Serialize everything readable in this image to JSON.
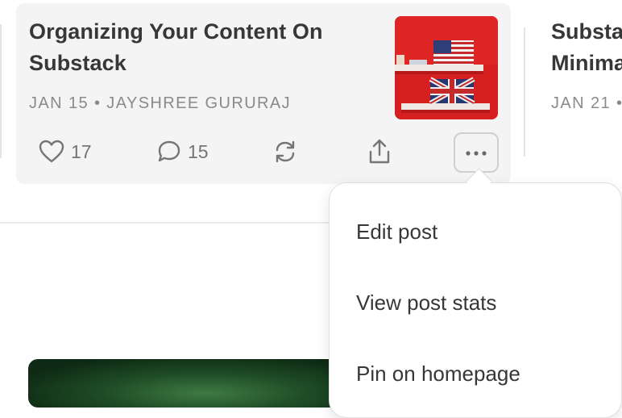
{
  "post": {
    "title": "Organizing Your Content On Substack",
    "meta": "JAN 15 • JAYSHREE GURURAJ",
    "likes": "17",
    "comments": "15"
  },
  "next_post": {
    "title_line1": "Substa",
    "title_line2": "Minima",
    "meta": "JAN 21 •"
  },
  "menu": {
    "items": [
      {
        "label": "Edit post"
      },
      {
        "label": "View post stats"
      },
      {
        "label": "Pin on homepage"
      }
    ]
  },
  "icons": {
    "like": "heart-icon",
    "comment": "comment-icon",
    "restack": "restack-icon",
    "share": "share-icon",
    "more": "more-dots-icon"
  },
  "colors": {
    "card_bg": "#f4f4f4",
    "text": "#363737",
    "muted": "#8a8a8a",
    "thumbnail_bg": "#d61f1f"
  }
}
